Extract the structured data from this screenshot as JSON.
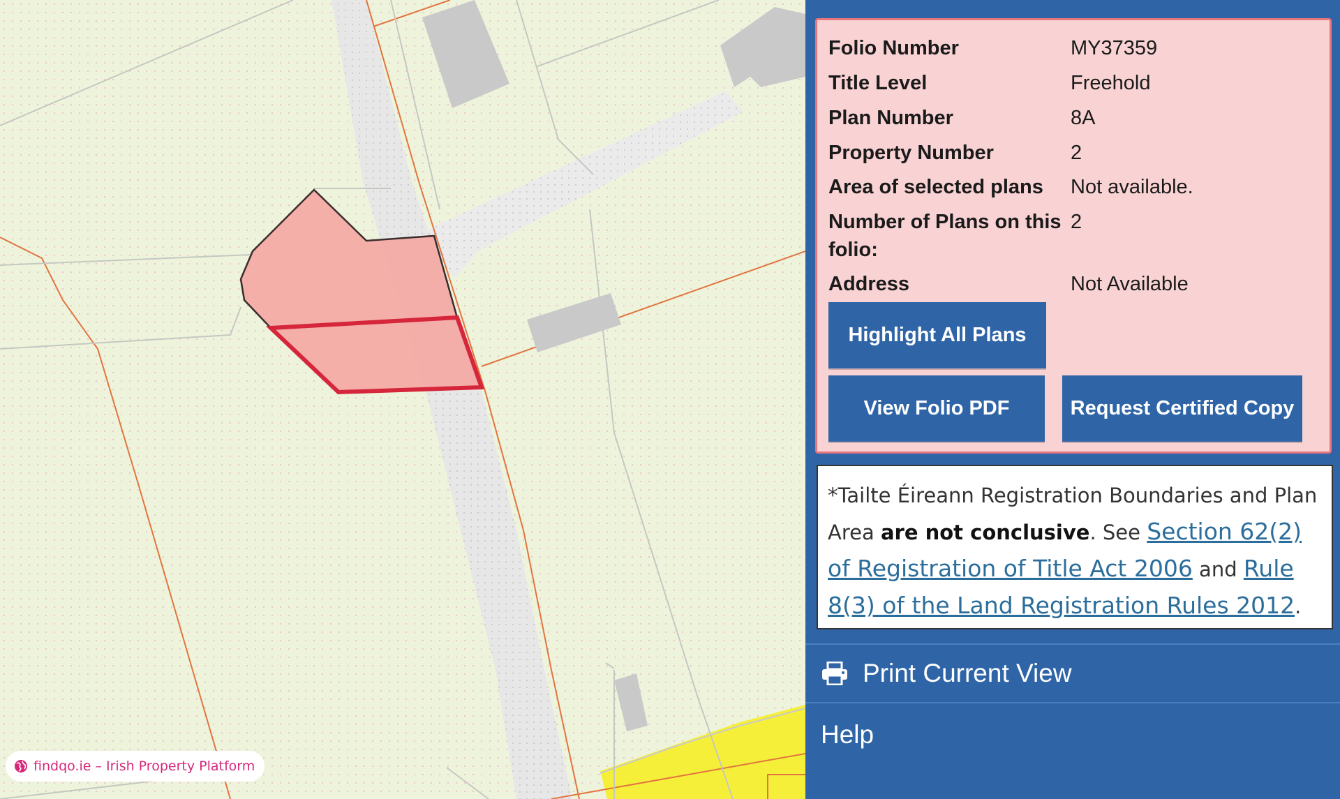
{
  "map": {
    "watermark": "findqo.ie – Irish Property Platform",
    "colors": {
      "land": "#eef4dc",
      "road": "#e6e6e6",
      "building": "#c8c8c8",
      "parcel_fill": "#f4a7a3",
      "parcel_outline": "#d6263b",
      "boundary": "#e2743f",
      "yellow_area": "#f6ef3a"
    }
  },
  "folio": {
    "rows": [
      {
        "label": "Folio Number",
        "value": "MY37359"
      },
      {
        "label": "Title Level",
        "value": "Freehold"
      },
      {
        "label": "Plan Number",
        "value": "8A"
      },
      {
        "label": "Property Number",
        "value": "2"
      },
      {
        "label": "Area of selected plans",
        "value": "Not available."
      },
      {
        "label": "Number of Plans on this folio:",
        "value": "2"
      },
      {
        "label": "Address",
        "value": "Not Available"
      }
    ],
    "buttons": {
      "highlight_all": "Highlight All Plans",
      "view_pdf": "View Folio PDF",
      "request_copy": "Request Certified Copy"
    }
  },
  "disclaimer": {
    "prefix": "*Tailte Éireann Registration Boundaries and Plan Area ",
    "bold": "are not conclusive",
    "mid1": ". See ",
    "link1": "Section 62(2) of Registration of Title Act 2006",
    "mid2": " and ",
    "link2": "Rule 8(3) of the Land Registration Rules 2012",
    "suffix": "."
  },
  "menu": {
    "print_label": "Print Current View",
    "help_label": "Help"
  },
  "colors": {
    "panel": "#2f65a7",
    "info_bg": "#f9d3d4",
    "info_border": "#e8747c",
    "link": "#2c6e9b"
  }
}
